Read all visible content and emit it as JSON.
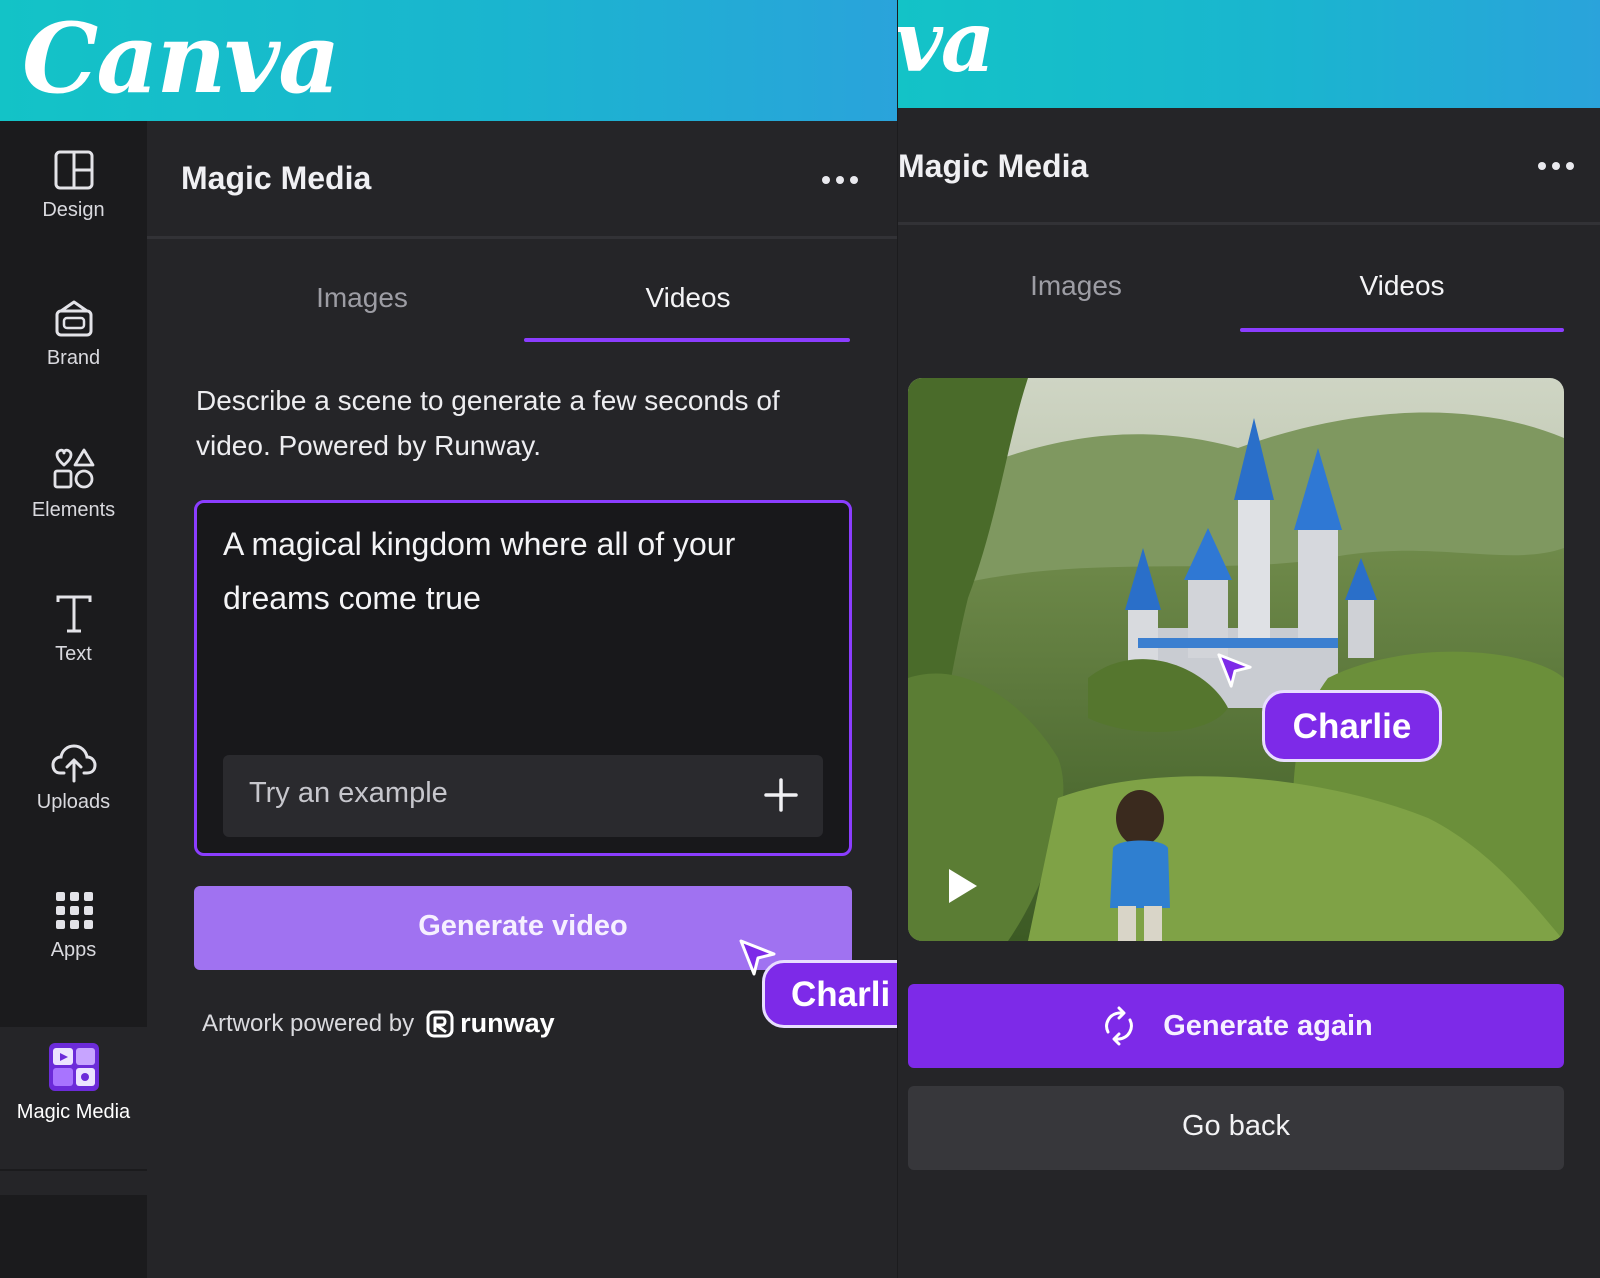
{
  "brand": {
    "logo_text": "Canva",
    "logo_text_cropped": "va"
  },
  "left_panel": {
    "rail": [
      {
        "label": "Design",
        "icon": "layout-icon"
      },
      {
        "label": "Brand",
        "icon": "brand-kit-icon"
      },
      {
        "label": "Elements",
        "icon": "shapes-icon"
      },
      {
        "label": "Text",
        "icon": "text-icon"
      },
      {
        "label": "Uploads",
        "icon": "upload-cloud-icon"
      },
      {
        "label": "Apps",
        "icon": "apps-grid-icon"
      },
      {
        "label": "Magic Media",
        "icon": "magic-media-icon",
        "active": true
      }
    ],
    "header": {
      "title": "Magic Media",
      "more_icon": "more-options-icon"
    },
    "tabs": [
      {
        "label": "Images",
        "active": false
      },
      {
        "label": "Videos",
        "active": true
      }
    ],
    "description": "Describe a scene to generate a few seconds of video. Powered by Runway.",
    "prompt": {
      "value": "A magical kingdom where all of your dreams come true",
      "example_label": "Try an example",
      "example_icon": "plus-icon"
    },
    "generate_button": "Generate video",
    "attribution": {
      "prefix": "Artwork powered by",
      "brand": "runway",
      "brand_icon": "runway-logo-icon"
    },
    "collaborator": {
      "name": "Charli",
      "cursor_icon": "cursor-arrow-icon"
    }
  },
  "right_panel": {
    "header": {
      "title": "Magic Media",
      "more_icon": "more-options-icon"
    },
    "tabs": [
      {
        "label": "Images",
        "active": false
      },
      {
        "label": "Videos",
        "active": true
      }
    ],
    "video": {
      "play_icon": "play-icon"
    },
    "collaborator": {
      "name": "Charlie",
      "cursor_icon": "cursor-arrow-icon"
    },
    "generate_again_button": "Generate again",
    "generate_again_icon": "refresh-icon",
    "go_back_button": "Go back"
  },
  "colors": {
    "accent": "#8b3dff",
    "button_purple": "#7d2ae8",
    "button_light_purple": "#a072f1",
    "panel_bg": "#252528",
    "rail_bg": "#1b1b1d",
    "brand_gradient_start": "#13c3c7",
    "brand_gradient_end": "#2aa3db"
  }
}
